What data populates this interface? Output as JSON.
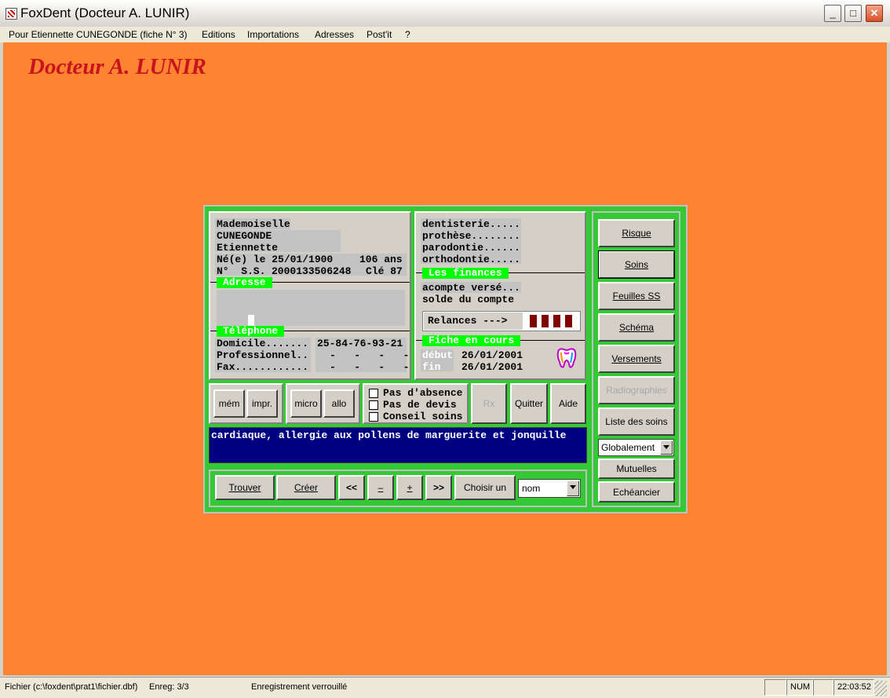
{
  "window": {
    "title": "FoxDent (Docteur A. LUNIR)",
    "controls": {
      "minimize": "_",
      "maximize": "□",
      "close": "✕"
    }
  },
  "menu": [
    "Pour Etiennette CUNEGONDE (fiche N° 3)",
    "Editions",
    "Importations",
    "Adresses",
    "Post'it",
    "?"
  ],
  "doctor_name": "Docteur A. LUNIR",
  "patient": {
    "civility": "Mademoiselle",
    "last_name": "CUNEGONDE",
    "first_name": "Etiennette",
    "birth": "Né(e) le 25/01/1900",
    "age": "106 ans",
    "ss_prefix": "N°  S.S.",
    "ss_number": "2000133506248",
    "ss_key": "Clé 87"
  },
  "sections": {
    "address": "Adresse",
    "phone": "Téléphone",
    "finances": "Les finances",
    "current_sheet": "Fiche en cours"
  },
  "phone": [
    {
      "label": "Domicile.......",
      "value": "25-84-76-93-21"
    },
    {
      "label": "Professionnel..",
      "value": "-   -   -   -"
    },
    {
      "label": "Fax............",
      "value": "-   -   -   -"
    }
  ],
  "treatments": [
    "dentisterie.....",
    "prothèse........",
    "parodontie......",
    "orthodontie....."
  ],
  "finances": {
    "deposit": "acompte versé...",
    "balance": "solde du compte",
    "reminders": "Relances --->",
    "reminder_count": 4,
    "reminder_color": "#800000"
  },
  "sheet": {
    "start_label": "début",
    "start_date": "26/01/2001",
    "end_label": "fin",
    "end_date": "26/01/2001",
    "icon": "tooth-icon"
  },
  "buttons": {
    "mem": "mém",
    "impr": "impr.",
    "micro": "micro",
    "allo": "allo",
    "rx": "Rx",
    "quit": "Quitter",
    "help": "Aide"
  },
  "checkboxes": [
    "Pas d'absence",
    "Pas de devis",
    "Conseil soins"
  ],
  "notes": "cardiaque, allergie aux pollens de marguerite et jonquille",
  "nav": {
    "find": "Trouver",
    "create": "Créer",
    "first": "<<",
    "prev": "–",
    "next": "+",
    "last": ">>",
    "choose": "Choisir un",
    "choose_by": "nom"
  },
  "side": {
    "risk": "Risque",
    "care": "Soins",
    "ss_sheets": "Feuilles SS",
    "schema": "Schéma",
    "payments": "Versements",
    "xrays": "Radiographies",
    "care_list": "Liste des soins",
    "scope": "Globalement",
    "insurers": "Mutuelles",
    "schedule": "Echéancier"
  },
  "status": {
    "file": "Fichier (c:\\foxdent\\prat1\\fichier.dbf)",
    "record": "Enreg: 3/3",
    "lock": "Enregistrement verrouillé",
    "num": "NUM",
    "time": "22:03:52"
  },
  "colors": {
    "background": "#ff8432",
    "form_frame": "#35c935",
    "section_label": "#00ff00",
    "notes_bg": "#000080",
    "doctor_name": "#c8141e"
  }
}
